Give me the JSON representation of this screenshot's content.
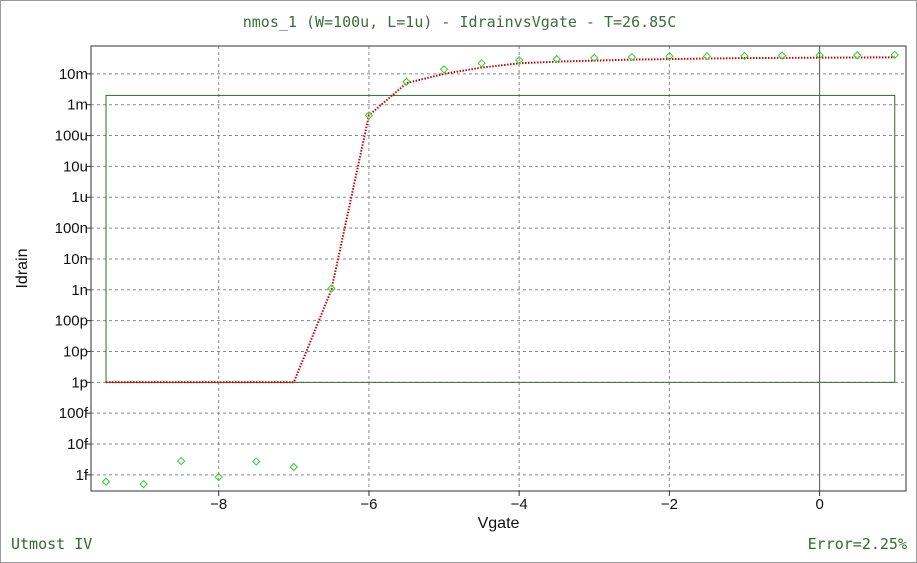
{
  "title": "nmos_1 (W=100u, L=1u) - IdrainvsVgate - T=26.85C",
  "footer": {
    "left": "Utmost IV",
    "right": "Error=2.25%"
  },
  "colors": {
    "text_green": "#3e6b3e",
    "model_line": "#cc0000",
    "measured_marker": "#33cc33",
    "box": "#2f6a2f",
    "grid": "#8a8a8a"
  },
  "chart_data": {
    "type": "scatter",
    "title": "nmos_1 (W=100u, L=1u) - IdrainvsVgate - T=26.85C",
    "xlabel": "Vgate",
    "ylabel": "Idrain",
    "xlim": [
      -9.7,
      1.15
    ],
    "ylim": [
      3e-16,
      0.08
    ],
    "y_scale": "log",
    "grid": true,
    "x_ticks": [
      {
        "value": -8,
        "label": "−8"
      },
      {
        "value": -6,
        "label": "−6"
      },
      {
        "value": -4,
        "label": "−4"
      },
      {
        "value": -2,
        "label": "−2"
      },
      {
        "value": 0,
        "label": "0"
      }
    ],
    "y_ticks": [
      {
        "value": 1e-15,
        "label": "1f"
      },
      {
        "value": 1e-14,
        "label": "10f"
      },
      {
        "value": 1e-13,
        "label": "100f"
      },
      {
        "value": 1e-12,
        "label": "1p"
      },
      {
        "value": 1e-11,
        "label": "10p"
      },
      {
        "value": 1e-10,
        "label": "100p"
      },
      {
        "value": 1e-09,
        "label": "1n"
      },
      {
        "value": 1e-08,
        "label": "10n"
      },
      {
        "value": 1e-07,
        "label": "100n"
      },
      {
        "value": 1e-06,
        "label": "1u"
      },
      {
        "value": 1e-05,
        "label": "10u"
      },
      {
        "value": 0.0001,
        "label": "100u"
      },
      {
        "value": 0.001,
        "label": "1m"
      },
      {
        "value": 0.01,
        "label": "10m"
      }
    ],
    "fit_window": {
      "x": [
        -9.5,
        1.0
      ],
      "y": [
        1e-12,
        0.002
      ]
    },
    "series": [
      {
        "kind": "measured",
        "marker": "diamond",
        "x": [
          -9.5,
          -9.0,
          -8.5,
          -8.0,
          -7.5,
          -7.0,
          -6.5,
          -6.0,
          -5.5,
          -5.0,
          -4.5,
          -4.0,
          -3.5,
          -3.0,
          -2.5,
          -2.0,
          -1.5,
          -1.0,
          -0.5,
          0.0,
          0.5,
          1.0
        ],
        "y": [
          6e-16,
          5e-16,
          2.8e-15,
          8.5e-16,
          2.7e-15,
          1.8e-15,
          1.1e-09,
          0.00045,
          0.0055,
          0.014,
          0.022,
          0.028,
          0.03,
          0.033,
          0.035,
          0.037,
          0.037,
          0.038,
          0.039,
          0.04,
          0.04,
          0.041
        ]
      },
      {
        "kind": "model",
        "style": "dotted",
        "x": [
          -9.5,
          -7.5,
          -7.0,
          -6.5,
          -6.0,
          -5.5,
          -5.0,
          -4.5,
          -4.0,
          -3.5,
          -3.0,
          -2.5,
          -2.0,
          -1.5,
          -1.0,
          -0.5,
          0.0,
          0.5,
          1.0
        ],
        "y": [
          1e-12,
          1e-12,
          1e-12,
          1e-09,
          0.00045,
          0.005,
          0.01,
          0.016,
          0.022,
          0.025,
          0.027,
          0.029,
          0.03,
          0.0315,
          0.0325,
          0.033,
          0.0335,
          0.034,
          0.0345
        ]
      }
    ]
  }
}
